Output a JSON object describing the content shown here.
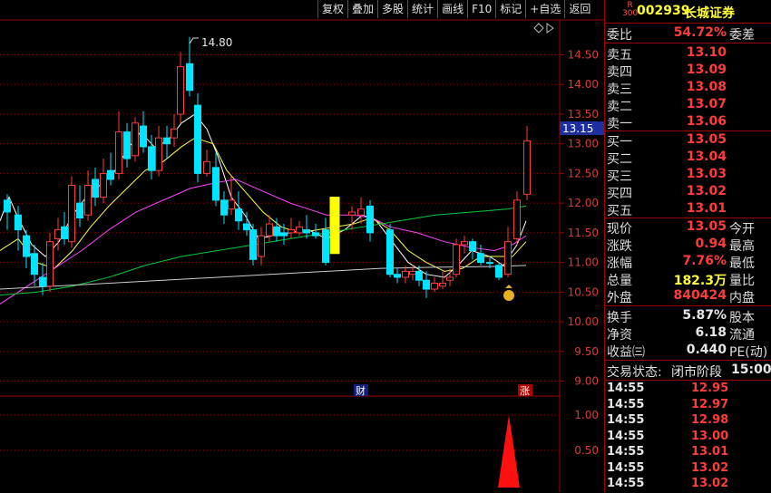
{
  "toolbar": [
    "复权",
    "叠加",
    "多股",
    "统计",
    "画线",
    "F10",
    "标记",
    "+自选",
    "返回"
  ],
  "chart": {
    "max_label": "14.80",
    "current_price_tag": "13.15",
    "y_ticks": [
      "14.50",
      "14.00",
      "13.50",
      "13.00",
      "12.50",
      "12.00",
      "11.50",
      "11.00",
      "10.50",
      "10.00",
      "9.50",
      "9.00"
    ],
    "volume_ticks": [
      "1.00",
      "0.50"
    ],
    "marker_cai": "财",
    "marker_zhang": "涨",
    "colors": {
      "up": "#ff3c3c",
      "down": "#00e5ff",
      "ma5": "#ffffff",
      "ma10": "#ffff55",
      "ma20": "#ff44ff",
      "ma60": "#00cc33",
      "ma120": "#cccccc"
    }
  },
  "stock": {
    "badge_top": "R",
    "badge_bottom": "300",
    "code": "002939",
    "name": "长城证券"
  },
  "weibi": {
    "label": "委比",
    "value": "54.72%",
    "right": "委差"
  },
  "asks": [
    {
      "label": "卖五",
      "price": "13.10"
    },
    {
      "label": "卖四",
      "price": "13.09"
    },
    {
      "label": "卖三",
      "price": "13.08"
    },
    {
      "label": "卖二",
      "price": "13.07"
    },
    {
      "label": "卖一",
      "price": "13.06"
    }
  ],
  "bids": [
    {
      "label": "买一",
      "price": "13.05"
    },
    {
      "label": "买二",
      "price": "13.04"
    },
    {
      "label": "买三",
      "price": "13.03"
    },
    {
      "label": "买四",
      "price": "13.02"
    },
    {
      "label": "买五",
      "price": "13.01"
    }
  ],
  "quote": [
    {
      "label": "现价",
      "value": "13.05",
      "right": "今开",
      "color": "#ff3c3c"
    },
    {
      "label": "涨跌",
      "value": "0.94",
      "right": "最高",
      "color": "#ff3c3c"
    },
    {
      "label": "涨幅",
      "value": "7.76%",
      "right": "最低",
      "color": "#ff3c3c"
    },
    {
      "label": "总量",
      "value": "182.3万",
      "right": "量比",
      "color": "#ffff33"
    },
    {
      "label": "外盘",
      "value": "840424",
      "right": "内盘",
      "color": "#ff3c3c"
    }
  ],
  "fundamentals": [
    {
      "label": "换手",
      "value": "5.87%",
      "right": "股本"
    },
    {
      "label": "净资",
      "value": "6.18",
      "right": "流通"
    },
    {
      "label": "收益㈢",
      "value": "0.440",
      "right": "PE(动)"
    }
  ],
  "status": {
    "label": "交易状态:",
    "value": "闭市阶段",
    "time": "15:00:"
  },
  "ticks": [
    {
      "time": "14:55",
      "price": "12.95"
    },
    {
      "time": "14:55",
      "price": "12.97"
    },
    {
      "time": "14:55",
      "price": "12.98"
    },
    {
      "time": "14:55",
      "price": "13.00"
    },
    {
      "time": "14:55",
      "price": "13.01"
    },
    {
      "time": "14:55",
      "price": "13.02"
    },
    {
      "time": "14:55",
      "price": "13.02"
    }
  ]
}
